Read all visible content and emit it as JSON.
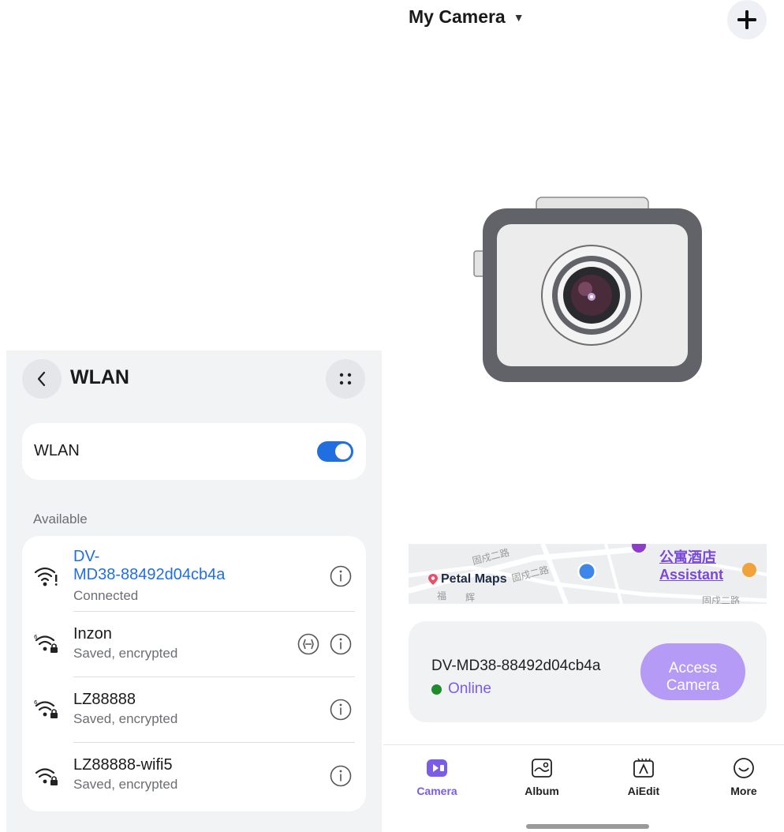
{
  "wlan": {
    "title": "WLAN",
    "toggle_label": "WLAN",
    "toggle_on": true,
    "section_label": "Available",
    "networks": [
      {
        "name_line1": "DV-",
        "name_line2": "MD38-88492d04cb4a",
        "status": "Connected"
      },
      {
        "name": "Inzon",
        "status": "Saved, encrypted"
      },
      {
        "name": "LZ88888",
        "status": "Saved, encrypted"
      },
      {
        "name": "LZ88888-wifi5",
        "status": "Saved, encrypted"
      }
    ],
    "accent_color": "#1f6fe0"
  },
  "camera_app": {
    "title": "My Camera",
    "map": {
      "brand": "Petal Maps",
      "link": "公寓酒店Assistant",
      "labels": [
        "固戍二路",
        "固戍二路",
        "福",
        "辉",
        "固戍二路"
      ]
    },
    "device": {
      "name": "DV-MD38-88492d04cb4a",
      "status": "Online",
      "access_label_line1": "Access",
      "access_label_line2": "Camera"
    },
    "tabs": [
      {
        "label": "Camera",
        "icon": "camera-tab-icon",
        "active": true
      },
      {
        "label": "Album",
        "icon": "album-icon",
        "active": false
      },
      {
        "label": "AiEdit",
        "icon": "aiedit-icon",
        "active": false
      },
      {
        "label": "More",
        "icon": "more-face-icon",
        "active": false
      }
    ],
    "accent_color": "#7b5ce6"
  }
}
